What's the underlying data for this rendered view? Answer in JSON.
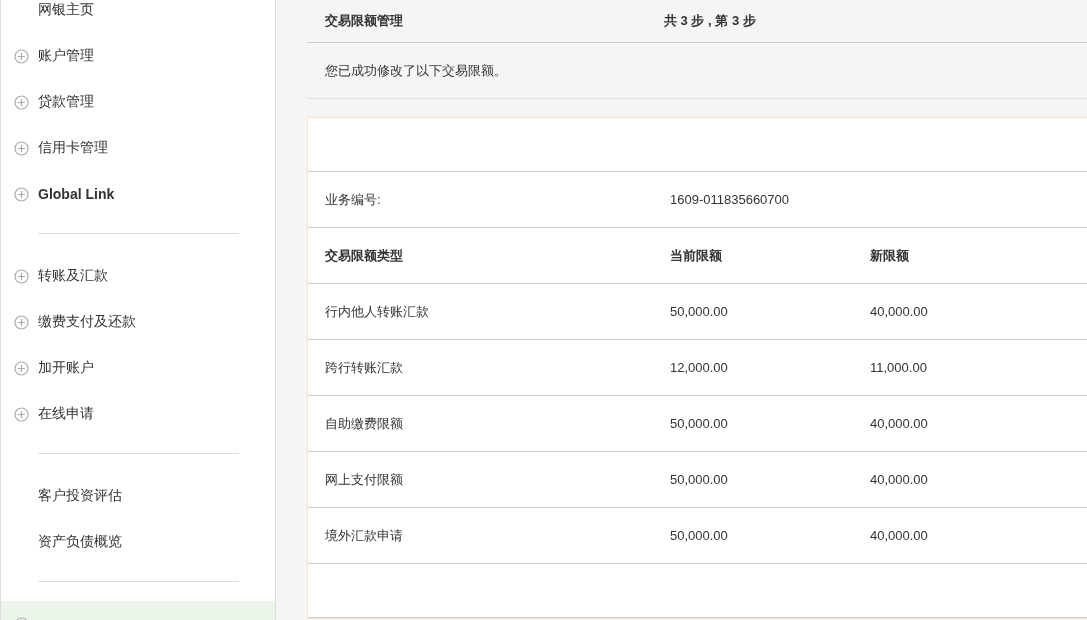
{
  "sidebar": {
    "groups": [
      {
        "items": [
          {
            "label": "网银主页",
            "expandable": false,
            "bold": false,
            "selected": false
          },
          {
            "label": "账户管理",
            "expandable": true,
            "bold": false,
            "selected": false
          },
          {
            "label": "贷款管理",
            "expandable": true,
            "bold": false,
            "selected": false
          },
          {
            "label": "信用卡管理",
            "expandable": true,
            "bold": false,
            "selected": false
          },
          {
            "label": "Global Link",
            "expandable": true,
            "bold": true,
            "selected": false
          }
        ]
      },
      {
        "items": [
          {
            "label": "转账及汇款",
            "expandable": true,
            "bold": false,
            "selected": false
          },
          {
            "label": "缴费支付及还款",
            "expandable": true,
            "bold": false,
            "selected": false
          },
          {
            "label": "加开账户",
            "expandable": true,
            "bold": false,
            "selected": false
          },
          {
            "label": "在线申请",
            "expandable": true,
            "bold": false,
            "selected": false
          }
        ]
      },
      {
        "items": [
          {
            "label": "客户投资评估",
            "expandable": false,
            "bold": false,
            "selected": false
          },
          {
            "label": "资产负债概览",
            "expandable": false,
            "bold": false,
            "selected": false
          }
        ]
      },
      {
        "items": [
          {
            "expandable": true,
            "selected": true
          }
        ]
      }
    ]
  },
  "header": {
    "title": "交易限额管理",
    "step": "共 3 步 , 第 3 步"
  },
  "message": "您已成功修改了以下交易限额。",
  "reference": {
    "label": "业务编号:",
    "value": "1609-011835660700"
  },
  "table": {
    "columns": [
      "交易限额类型",
      "当前限额",
      "新限额"
    ],
    "rows": [
      [
        "行内他人转账汇款",
        "50,000.00",
        "40,000.00"
      ],
      [
        "跨行转账汇款",
        "12,000.00",
        "11,000.00"
      ],
      [
        "自助缴费限额",
        "50,000.00",
        "40,000.00"
      ],
      [
        "网上支付限额",
        "50,000.00",
        "40,000.00"
      ],
      [
        "境外汇款申请",
        "50,000.00",
        "40,000.00"
      ]
    ]
  }
}
